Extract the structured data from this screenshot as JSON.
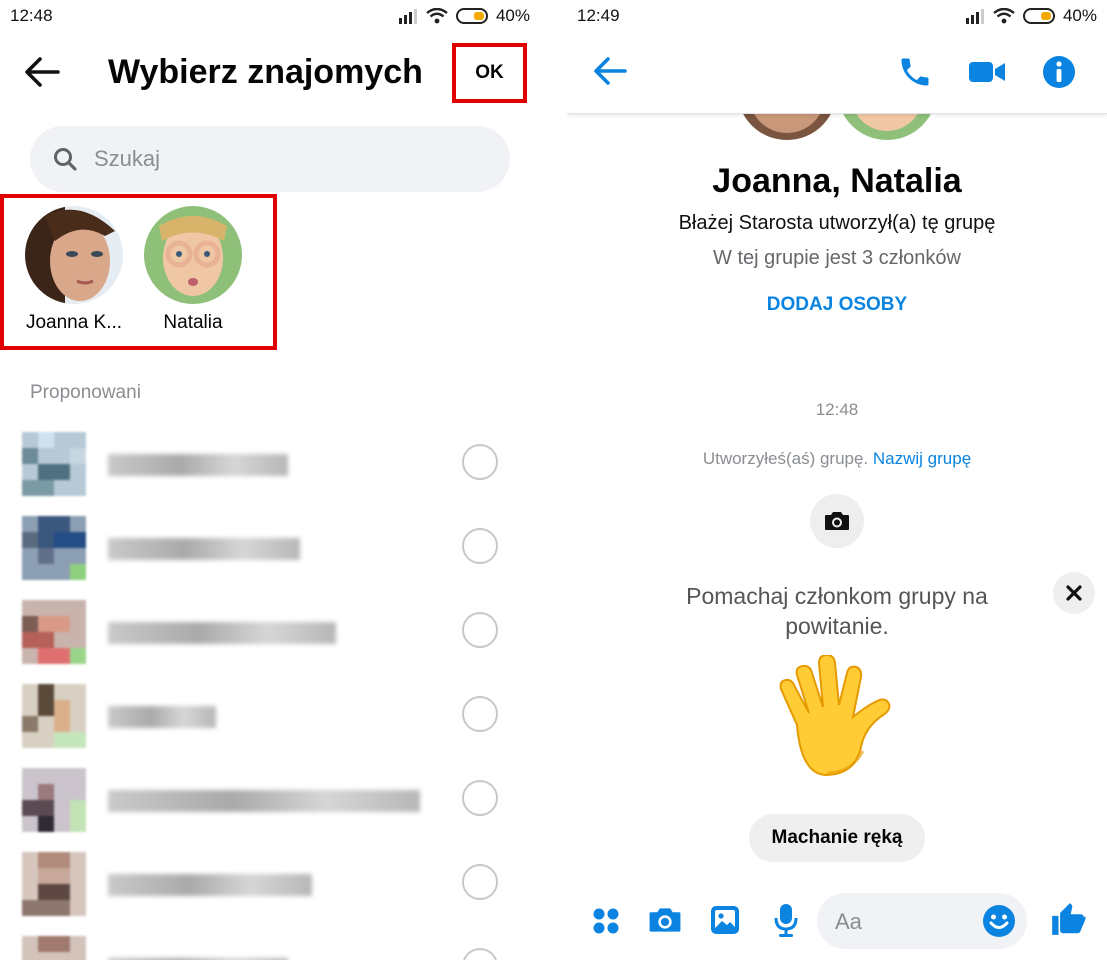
{
  "left": {
    "status": {
      "time": "12:48",
      "battery": "40%"
    },
    "header": {
      "title": "Wybierz znajomych",
      "ok_label": "OK",
      "back_icon": "arrow-left-icon"
    },
    "search": {
      "placeholder": "Szukaj",
      "icon": "search-icon"
    },
    "selected": [
      {
        "name": "Joanna K..."
      },
      {
        "name": "Natalia"
      }
    ],
    "section_label": "Proponowani"
  },
  "right": {
    "status": {
      "time": "12:49",
      "battery": "40%"
    },
    "header": {
      "icons": [
        "arrow-left-icon",
        "phone-icon",
        "video-icon",
        "info-icon"
      ]
    },
    "group": {
      "name": "Joanna, Natalia",
      "created_by": "Błażej Starosta utworzył(a) tę grupę",
      "member_count": "W tej grupie jest 3 członków",
      "add_people": "DODAJ OSOBY"
    },
    "timestamp": "12:48",
    "created_notice": {
      "text": "Utworzyłeś(aś) grupę.",
      "link": "Nazwij grupę"
    },
    "wave": {
      "prompt": "Pomachaj członkom grupy na powitanie.",
      "button": "Machanie ręką"
    },
    "composer": {
      "placeholder": "Aa",
      "icons": [
        "apps-icon",
        "camera-icon",
        "image-icon",
        "mic-icon",
        "emoji-icon",
        "thumbs-up-icon"
      ]
    },
    "colors": {
      "accent": "#0a84e0",
      "highlight": "#e00000"
    }
  }
}
